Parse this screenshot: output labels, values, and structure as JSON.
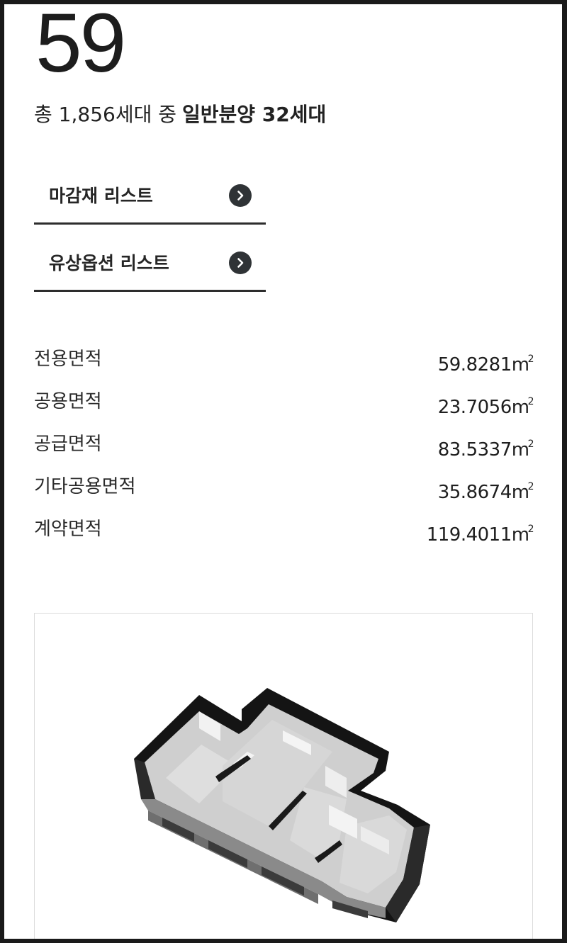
{
  "unit": {
    "type_number": "59",
    "summary_lead": "총 1,856세대 중",
    "summary_strong": "일반분양 32세대"
  },
  "links": [
    {
      "label": "마감재 리스트",
      "icon": "chevron-right-icon"
    },
    {
      "label": "유상옵션 리스트",
      "icon": "chevron-right-icon"
    }
  ],
  "areas": [
    {
      "name": "전용면적",
      "value": "59.8281",
      "unit": "m",
      "unit_sup": "2"
    },
    {
      "name": "공용면적",
      "value": "23.7056",
      "unit": "m",
      "unit_sup": "2"
    },
    {
      "name": "공급면적",
      "value": "83.5337",
      "unit": "m",
      "unit_sup": "2"
    },
    {
      "name": "기타공용면적",
      "value": "35.8674",
      "unit": "m",
      "unit_sup": "2"
    },
    {
      "name": "계약면적",
      "value": "119.4011",
      "unit": "m",
      "unit_sup": "2"
    }
  ],
  "colors": {
    "text": "#222222",
    "arrow_bg": "#2f3336",
    "divider": "#2d2d2d",
    "wall": "#111111"
  }
}
